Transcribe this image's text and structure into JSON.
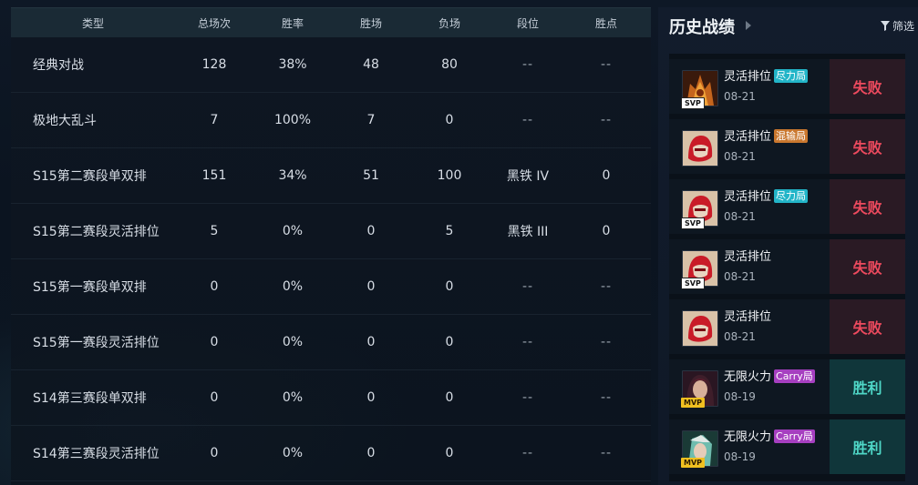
{
  "stats_table": {
    "headers": [
      "类型",
      "总场次",
      "胜率",
      "胜场",
      "负场",
      "段位",
      "胜点"
    ],
    "rows": [
      {
        "type": "经典对战",
        "total": "128",
        "winrate": "38%",
        "wins": "48",
        "losses": "80",
        "rank": "--",
        "lp": "--"
      },
      {
        "type": "极地大乱斗",
        "total": "7",
        "winrate": "100%",
        "wins": "7",
        "losses": "0",
        "rank": "--",
        "lp": "--"
      },
      {
        "type": "S15第二赛段单双排",
        "total": "151",
        "winrate": "34%",
        "wins": "51",
        "losses": "100",
        "rank": "黑铁 IV",
        "lp": "0"
      },
      {
        "type": "S15第二赛段灵活排位",
        "total": "5",
        "winrate": "0%",
        "wins": "0",
        "losses": "5",
        "rank": "黑铁 III",
        "lp": "0"
      },
      {
        "type": "S15第一赛段单双排",
        "total": "0",
        "winrate": "0%",
        "wins": "0",
        "losses": "0",
        "rank": "--",
        "lp": "--"
      },
      {
        "type": "S15第一赛段灵活排位",
        "total": "0",
        "winrate": "0%",
        "wins": "0",
        "losses": "0",
        "rank": "--",
        "lp": "--"
      },
      {
        "type": "S14第三赛段单双排",
        "total": "0",
        "winrate": "0%",
        "wins": "0",
        "losses": "0",
        "rank": "--",
        "lp": "--"
      },
      {
        "type": "S14第三赛段灵活排位",
        "total": "0",
        "winrate": "0%",
        "wins": "0",
        "losses": "0",
        "rank": "--",
        "lp": "--"
      }
    ]
  },
  "history": {
    "title": "历史战绩",
    "filter_label": "筛选",
    "filter_icon": "funnel-icon",
    "matches": [
      {
        "mode": "灵活排位",
        "tag": "尽力局",
        "tag_color": "#22b5c8",
        "date": "08-21",
        "result": "失败",
        "result_type": "lose",
        "badge": "SVP",
        "champion_icon": "champion-flame-demon-icon"
      },
      {
        "mode": "灵活排位",
        "tag": "混输局",
        "tag_color": "#c9772e",
        "date": "08-21",
        "result": "失败",
        "result_type": "lose",
        "badge": "",
        "champion_icon": "champion-red-mask-icon"
      },
      {
        "mode": "灵活排位",
        "tag": "尽力局",
        "tag_color": "#22b5c8",
        "date": "08-21",
        "result": "失败",
        "result_type": "lose",
        "badge": "SVP",
        "champion_icon": "champion-red-mask-icon"
      },
      {
        "mode": "灵活排位",
        "tag": "",
        "tag_color": "",
        "date": "08-21",
        "result": "失败",
        "result_type": "lose",
        "badge": "SVP",
        "champion_icon": "champion-red-mask-icon"
      },
      {
        "mode": "灵活排位",
        "tag": "",
        "tag_color": "",
        "date": "08-21",
        "result": "失败",
        "result_type": "lose",
        "badge": "",
        "champion_icon": "champion-red-mask-icon"
      },
      {
        "mode": "无限火力",
        "tag": "Carry局",
        "tag_color": "#a63fc0",
        "date": "08-19",
        "result": "胜利",
        "result_type": "win",
        "badge": "MVP",
        "champion_icon": "champion-dark-haired-icon"
      },
      {
        "mode": "无限火力",
        "tag": "Carry局",
        "tag_color": "#a63fc0",
        "date": "08-19",
        "result": "胜利",
        "result_type": "win",
        "badge": "MVP",
        "champion_icon": "champion-green-warrior-icon"
      }
    ]
  },
  "colors": {
    "lose_text": "#ee4a5e",
    "win_text": "#4fd7c7",
    "lose_bg": "#2a1a24",
    "win_bg": "#10363a"
  }
}
